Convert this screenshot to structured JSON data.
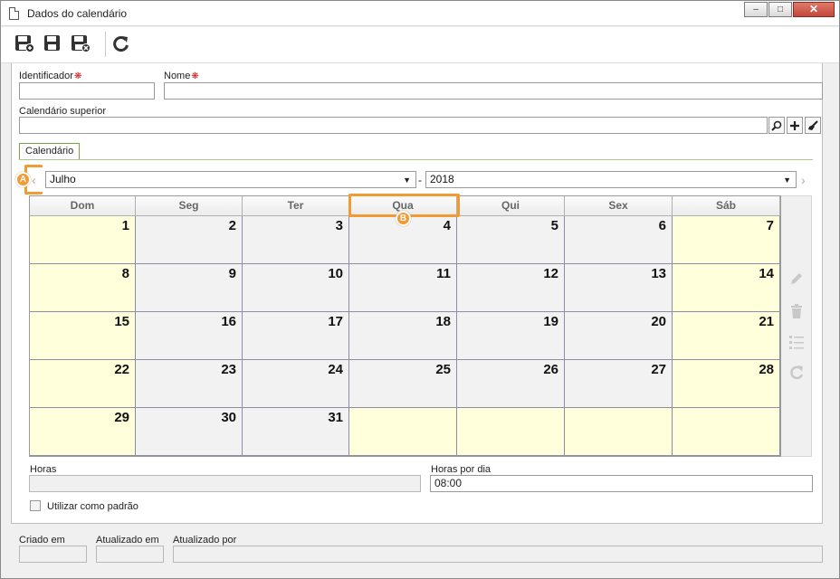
{
  "window": {
    "title": "Dados do calendário",
    "buttons": {
      "minimize": "–",
      "maximize": "□",
      "close": "✕"
    }
  },
  "toolbar": {
    "icons": [
      "save-new-icon",
      "save-icon",
      "save-close-icon",
      "refresh-icon"
    ]
  },
  "form": {
    "identificador_label": "Identificador",
    "nome_label": "Nome",
    "required_mark": "❋",
    "identificador_value": "",
    "nome_value": "",
    "calendario_superior_label": "Calendário superior",
    "calendario_superior_value": ""
  },
  "tab": {
    "label": "Calendário"
  },
  "calendar": {
    "month": "Julho",
    "separator": "-",
    "year": "2018",
    "weekdays": [
      "Dom",
      "Seg",
      "Ter",
      "Qua",
      "Qui",
      "Sex",
      "Sáb"
    ],
    "weeks": [
      [
        "1",
        "2",
        "3",
        "4",
        "5",
        "6",
        "7"
      ],
      [
        "8",
        "9",
        "10",
        "11",
        "12",
        "13",
        "14"
      ],
      [
        "15",
        "16",
        "17",
        "18",
        "19",
        "20",
        "21"
      ],
      [
        "22",
        "23",
        "24",
        "25",
        "26",
        "27",
        "28"
      ],
      [
        "29",
        "30",
        "31",
        "",
        "",
        "",
        ""
      ]
    ],
    "weekend_color": "#ffffdc",
    "weekday_color": "#f2f2f2",
    "side_icons": [
      "edit-icon",
      "delete-icon",
      "list-icon",
      "refresh-icon"
    ]
  },
  "horas": {
    "label": "Horas",
    "value": ""
  },
  "horas_por_dia": {
    "label": "Horas por dia",
    "value": "08:00"
  },
  "utilizar_padrao": {
    "label": "Utilizar como padrão",
    "checked": false
  },
  "footer": {
    "criado_em_label": "Criado em",
    "criado_em_value": "",
    "atualizado_em_label": "Atualizado em",
    "atualizado_em_value": "",
    "atualizado_por_label": "Atualizado por",
    "atualizado_por_value": ""
  },
  "annotations": {
    "a": "A",
    "b": "B",
    "color": "#f39a32"
  }
}
